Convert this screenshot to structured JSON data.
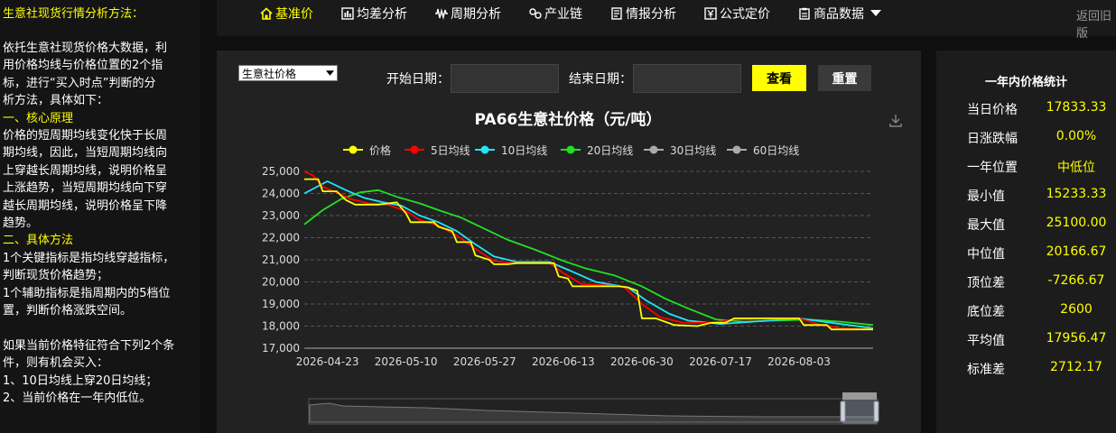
{
  "sidebar": {
    "title": "生意社现货行情分析方法：",
    "lines": [
      {
        "t": "依托生意社现货价格大数据，利",
        "c": "w"
      },
      {
        "t": "用价格均线与价格位置的2个指",
        "c": "w"
      },
      {
        "t": "标，进行“买入时点”判断的分",
        "c": "w"
      },
      {
        "t": "析方法，具体如下：",
        "c": "w"
      },
      {
        "t": "一、核心原理",
        "c": "y"
      },
      {
        "t": "价格的短周期均线变化快于长周",
        "c": "w"
      },
      {
        "t": "期均线，因此，当短周期均线向",
        "c": "w"
      },
      {
        "t": "上穿越长周期均线，说明价格呈",
        "c": "w"
      },
      {
        "t": "上涨趋势，当短周期均线向下穿",
        "c": "w"
      },
      {
        "t": "越长周期均线，说明价格呈下降",
        "c": "w"
      },
      {
        "t": "趋势。",
        "c": "w"
      },
      {
        "t": "二、具体方法",
        "c": "y"
      },
      {
        "t": "1个关键指标是指均线穿越指标，",
        "c": "w"
      },
      {
        "t": "判断现货价格趋势；",
        "c": "w"
      },
      {
        "t": "1个辅助指标是指周期内的5档位",
        "c": "w"
      },
      {
        "t": "置，判断价格涨跌空间。",
        "c": "w"
      },
      {
        "t": "",
        "c": "w"
      },
      {
        "t": "如果当前价格特征符合下列2个条",
        "c": "w"
      },
      {
        "t": "件，则有机会买入：",
        "c": "w"
      },
      {
        "t": "1、10日均线上穿20日均线；",
        "c": "w"
      },
      {
        "t": "2、当前价格在一年内低位。",
        "c": "w"
      }
    ]
  },
  "nav": {
    "items": [
      {
        "label": "基准价",
        "icon": "home-icon",
        "active": true
      },
      {
        "label": "均差分析",
        "icon": "bar-chart-icon",
        "active": false
      },
      {
        "label": "周期分析",
        "icon": "wave-icon",
        "active": false
      },
      {
        "label": "产业链",
        "icon": "link-icon",
        "active": false
      },
      {
        "label": "情报分析",
        "icon": "document-icon",
        "active": false
      },
      {
        "label": "公式定价",
        "icon": "yen-icon",
        "active": false
      },
      {
        "label": "商品数据",
        "icon": "clipboard-icon",
        "active": false
      }
    ],
    "back_label": "返回旧版"
  },
  "filter": {
    "select_value": "生意社价格",
    "start_label": "开始日期：",
    "end_label": "结束日期：",
    "start_value": "",
    "end_value": "",
    "view_label": "查看",
    "reset_label": "重置"
  },
  "stats": {
    "title": "一年内价格统计",
    "rows": [
      {
        "k": "当日价格",
        "v": "17833.33"
      },
      {
        "k": "日涨跌幅",
        "v": "0.00%"
      },
      {
        "k": "一年位置",
        "v": "中低位"
      },
      {
        "k": "最小值",
        "v": "15233.33"
      },
      {
        "k": "最大值",
        "v": "25100.00"
      },
      {
        "k": "中位值",
        "v": "20166.67"
      },
      {
        "k": "顶位差",
        "v": "-7266.67"
      },
      {
        "k": "底位差",
        "v": "2600"
      },
      {
        "k": "平均值",
        "v": "17956.47"
      },
      {
        "k": "标准差",
        "v": "2712.17"
      }
    ]
  },
  "chart_data": {
    "type": "line",
    "title": "PA66生意社价格（元/吨）",
    "ylim": [
      17000,
      25000
    ],
    "yticks": [
      "25,000",
      "24,000",
      "23,000",
      "22,000",
      "21,000",
      "20,000",
      "19,000",
      "18,000",
      "17,000"
    ],
    "xticks": [
      "2026-04-23",
      "2026-05-10",
      "2026-05-27",
      "2026-06-13",
      "2026-06-30",
      "2026-07-17",
      "2026-08-03"
    ],
    "x_start": "2026-04-18",
    "x_end": "2026-08-19",
    "grid": true,
    "legend_position": "top",
    "colors": {
      "价格": "#ffff00",
      "5日均线": "#ff0000",
      "10日均线": "#22e5f5",
      "20日均线": "#22e022",
      "30日均线": "#aaaaaa",
      "60日均线": "#aaaaaa"
    },
    "series": [
      {
        "name": "价格",
        "visible": true,
        "points": [
          [
            "2026-04-18",
            24650
          ],
          [
            "2026-04-21",
            24650
          ],
          [
            "2026-04-22",
            24100
          ],
          [
            "2026-04-25",
            24100
          ],
          [
            "2026-04-27",
            23700
          ],
          [
            "2026-04-29",
            23500
          ],
          [
            "2026-05-04",
            23500
          ],
          [
            "2026-05-08",
            23600
          ],
          [
            "2026-05-10",
            23100
          ],
          [
            "2026-05-11",
            22700
          ],
          [
            "2026-05-16",
            22700
          ],
          [
            "2026-05-17",
            22500
          ],
          [
            "2026-05-20",
            22300
          ],
          [
            "2026-05-21",
            21800
          ],
          [
            "2026-05-24",
            21800
          ],
          [
            "2026-05-25",
            21200
          ],
          [
            "2026-05-28",
            21000
          ],
          [
            "2026-05-29",
            20800
          ],
          [
            "2026-06-01",
            20800
          ],
          [
            "2026-06-03",
            20850
          ],
          [
            "2026-06-11",
            20850
          ],
          [
            "2026-06-12",
            20250
          ],
          [
            "2026-06-14",
            20150
          ],
          [
            "2026-06-15",
            19800
          ],
          [
            "2026-06-25",
            19800
          ],
          [
            "2026-06-27",
            19750
          ],
          [
            "2026-06-29",
            19600
          ],
          [
            "2026-06-30",
            18350
          ],
          [
            "2026-07-03",
            18350
          ],
          [
            "2026-07-07",
            18050
          ],
          [
            "2026-07-12",
            18000
          ],
          [
            "2026-07-15",
            18150
          ],
          [
            "2026-07-18",
            18150
          ],
          [
            "2026-07-20",
            18350
          ],
          [
            "2026-08-03",
            18350
          ],
          [
            "2026-08-04",
            18050
          ],
          [
            "2026-08-09",
            18050
          ],
          [
            "2026-08-10",
            17850
          ],
          [
            "2026-08-19",
            17850
          ]
        ]
      },
      {
        "name": "5日均线",
        "visible": true,
        "points": [
          [
            "2026-04-18",
            25000
          ],
          [
            "2026-04-20",
            24800
          ],
          [
            "2026-04-22",
            24300
          ],
          [
            "2026-04-25",
            24050
          ],
          [
            "2026-04-28",
            23750
          ],
          [
            "2026-05-02",
            23550
          ],
          [
            "2026-05-06",
            23500
          ],
          [
            "2026-05-10",
            23200
          ],
          [
            "2026-05-13",
            22800
          ],
          [
            "2026-05-17",
            22550
          ],
          [
            "2026-05-21",
            22100
          ],
          [
            "2026-05-25",
            21500
          ],
          [
            "2026-05-29",
            20950
          ],
          [
            "2026-06-02",
            20850
          ],
          [
            "2026-06-10",
            20850
          ],
          [
            "2026-06-13",
            20400
          ],
          [
            "2026-06-17",
            19900
          ],
          [
            "2026-06-26",
            19800
          ],
          [
            "2026-06-30",
            19000
          ],
          [
            "2026-07-04",
            18400
          ],
          [
            "2026-07-09",
            18150
          ],
          [
            "2026-07-15",
            18150
          ],
          [
            "2026-07-20",
            18300
          ],
          [
            "2026-08-03",
            18350
          ],
          [
            "2026-08-07",
            18100
          ],
          [
            "2026-08-12",
            17900
          ],
          [
            "2026-08-19",
            17850
          ]
        ]
      },
      {
        "name": "10日均线",
        "visible": true,
        "points": [
          [
            "2026-04-18",
            24000
          ],
          [
            "2026-04-23",
            24550
          ],
          [
            "2026-04-27",
            24150
          ],
          [
            "2026-05-01",
            23800
          ],
          [
            "2026-05-05",
            23600
          ],
          [
            "2026-05-09",
            23450
          ],
          [
            "2026-05-13",
            23000
          ],
          [
            "2026-05-17",
            22700
          ],
          [
            "2026-05-21",
            22300
          ],
          [
            "2026-05-25",
            21700
          ],
          [
            "2026-05-29",
            21150
          ],
          [
            "2026-06-03",
            20900
          ],
          [
            "2026-06-10",
            20900
          ],
          [
            "2026-06-14",
            20550
          ],
          [
            "2026-06-20",
            20000
          ],
          [
            "2026-06-27",
            19750
          ],
          [
            "2026-07-01",
            19150
          ],
          [
            "2026-07-06",
            18550
          ],
          [
            "2026-07-10",
            18250
          ],
          [
            "2026-07-17",
            18100
          ],
          [
            "2026-07-24",
            18200
          ],
          [
            "2026-08-03",
            18350
          ],
          [
            "2026-08-10",
            18150
          ],
          [
            "2026-08-19",
            17900
          ]
        ]
      },
      {
        "name": "20日均线",
        "visible": true,
        "points": [
          [
            "2026-04-18",
            22600
          ],
          [
            "2026-04-22",
            23250
          ],
          [
            "2026-04-26",
            23750
          ],
          [
            "2026-04-30",
            24050
          ],
          [
            "2026-05-04",
            24150
          ],
          [
            "2026-05-08",
            23850
          ],
          [
            "2026-05-13",
            23550
          ],
          [
            "2026-05-17",
            23250
          ],
          [
            "2026-05-22",
            22900
          ],
          [
            "2026-05-27",
            22400
          ],
          [
            "2026-06-01",
            21900
          ],
          [
            "2026-06-07",
            21450
          ],
          [
            "2026-06-13",
            20950
          ],
          [
            "2026-06-18",
            20600
          ],
          [
            "2026-06-24",
            20300
          ],
          [
            "2026-06-30",
            19800
          ],
          [
            "2026-07-05",
            19250
          ],
          [
            "2026-07-10",
            18800
          ],
          [
            "2026-07-16",
            18300
          ],
          [
            "2026-07-22",
            18200
          ],
          [
            "2026-07-29",
            18250
          ],
          [
            "2026-08-05",
            18300
          ],
          [
            "2026-08-12",
            18200
          ],
          [
            "2026-08-19",
            18050
          ]
        ]
      },
      {
        "name": "30日均线",
        "visible": false,
        "points": []
      },
      {
        "name": "60日均线",
        "visible": false,
        "points": []
      }
    ]
  }
}
